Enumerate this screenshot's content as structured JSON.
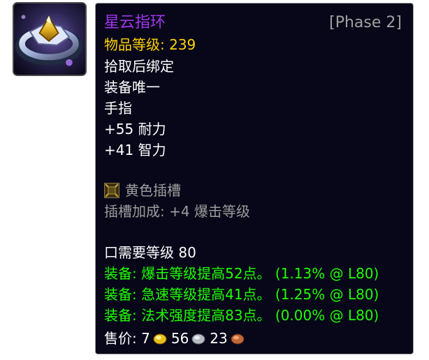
{
  "item": {
    "name": "星云指环",
    "phase": "[Phase 2]",
    "item_level": "物品等级: 239",
    "binding": "拾取后绑定",
    "unique": "装备唯一",
    "slot": "手指",
    "stat_stamina": "+55 耐力",
    "stat_intellect": "+41 智力",
    "socket_label": "黄色插槽",
    "socket_bonus": "插槽加成: +4 爆击等级",
    "required_level": "口需要等级 80",
    "equip_effects": [
      "装备: 爆击等级提高52点。 (1.13% @ L80)",
      "装备: 急速等级提高41点。 (1.25% @ L80)",
      "装备: 法术强度提高83点。 (0.00% @ L80)"
    ],
    "sell_label": "售价:",
    "sell_gold": "7",
    "sell_silver": "56",
    "sell_copper": "23"
  },
  "colors": {
    "epic": "#a335ee",
    "item_level": "#ffd100",
    "equip": "#1eff00",
    "inactive": "#9d9d9d",
    "phase": "#a0a0a0"
  },
  "icons": {
    "item": "ring-icon",
    "socket": "yellow-socket-icon",
    "gold": "gold-coin-icon",
    "silver": "silver-coin-icon",
    "copper": "copper-coin-icon"
  }
}
